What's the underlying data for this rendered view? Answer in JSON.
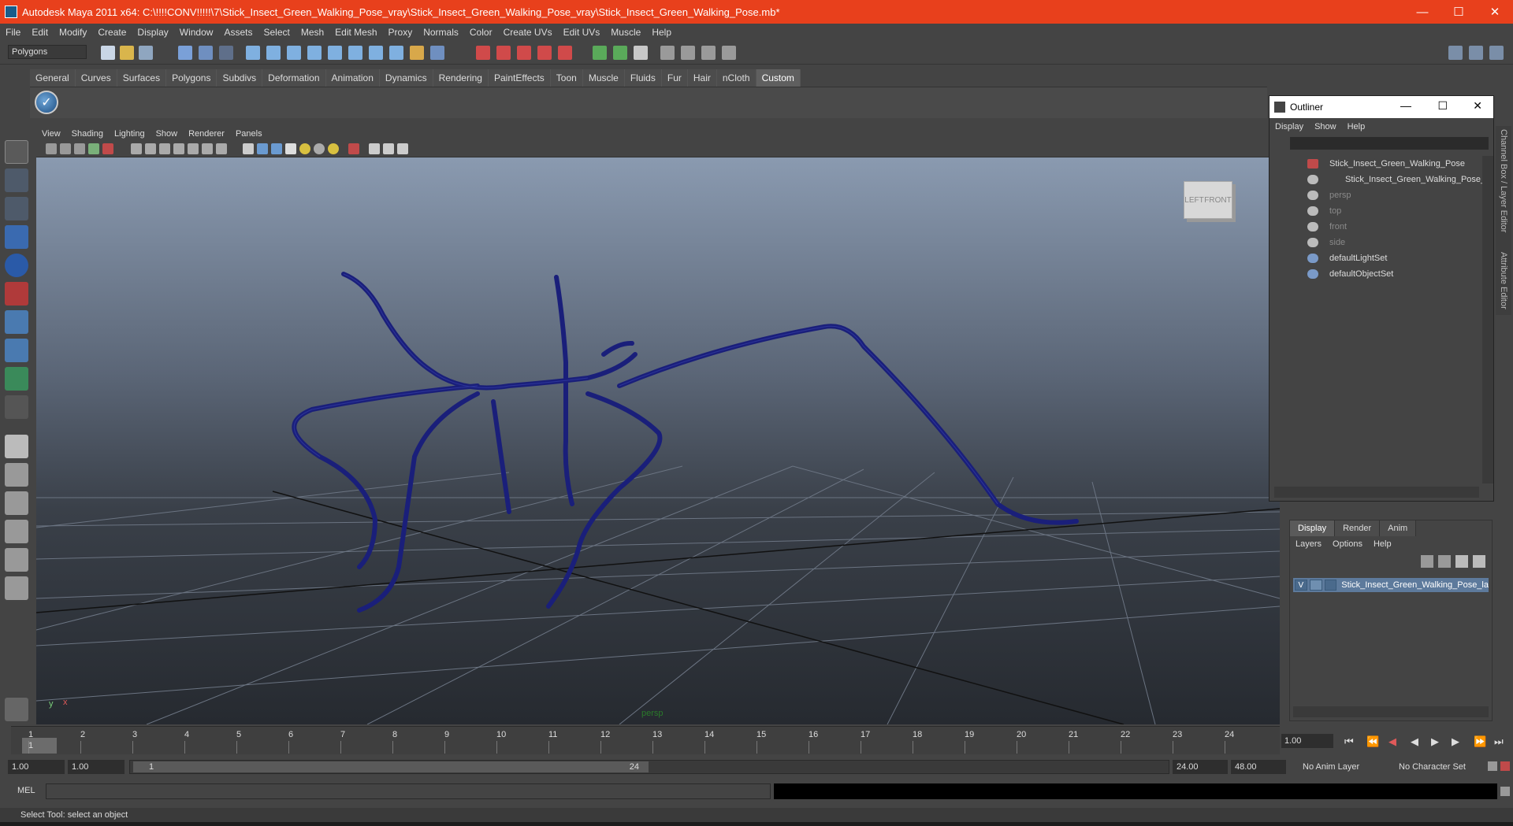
{
  "window": {
    "title": "Autodesk Maya 2011 x64: C:\\!!!!CONV!!!!!\\7\\Stick_Insect_Green_Walking_Pose_vray\\Stick_Insect_Green_Walking_Pose_vray\\Stick_Insect_Green_Walking_Pose.mb*",
    "minimize": "—",
    "maximize": "☐",
    "close": "✕"
  },
  "menubar": [
    "File",
    "Edit",
    "Modify",
    "Create",
    "Display",
    "Window",
    "Assets",
    "Select",
    "Mesh",
    "Edit Mesh",
    "Proxy",
    "Normals",
    "Color",
    "Create UVs",
    "Edit UVs",
    "Muscle",
    "Help"
  ],
  "toolbar": {
    "mode": "Polygons"
  },
  "shelf": {
    "tabs": [
      "General",
      "Curves",
      "Surfaces",
      "Polygons",
      "Subdivs",
      "Deformation",
      "Animation",
      "Dynamics",
      "Rendering",
      "PaintEffects",
      "Toon",
      "Muscle",
      "Fluids",
      "Fur",
      "Hair",
      "nCloth",
      "Custom"
    ],
    "active_tab": "Custom",
    "button_glyph": "✓"
  },
  "viewport": {
    "menus": [
      "View",
      "Shading",
      "Lighting",
      "Show",
      "Renderer",
      "Panels"
    ],
    "camera_label": "persp",
    "viewcube_left": "LEFT",
    "viewcube_front": "FRONT",
    "axis_y": "y",
    "axis_x": "x"
  },
  "outliner": {
    "title": "Outliner",
    "menus": [
      "Display",
      "Show",
      "Help"
    ],
    "items": [
      {
        "label": "Stick_Insect_Green_Walking_Pose",
        "dim": false
      },
      {
        "label": "Stick_Insect_Green_Walking_Pose_",
        "dim": false
      },
      {
        "label": "persp",
        "dim": true
      },
      {
        "label": "top",
        "dim": true
      },
      {
        "label": "front",
        "dim": true
      },
      {
        "label": "side",
        "dim": true
      },
      {
        "label": "defaultLightSet",
        "dim": false
      },
      {
        "label": "defaultObjectSet",
        "dim": false
      }
    ]
  },
  "sidetabs": {
    "channel_box": "Channel Box / Layer Editor",
    "attribute_editor": "Attribute Editor"
  },
  "layers": {
    "tabs": [
      "Display",
      "Render",
      "Anim"
    ],
    "active_tab": "Display",
    "menus": [
      "Layers",
      "Options",
      "Help"
    ],
    "layer_visible": "V",
    "layer_name": "Stick_Insect_Green_Walking_Pose_la"
  },
  "timeline": {
    "ticks": [
      "1",
      "2",
      "3",
      "4",
      "5",
      "6",
      "7",
      "8",
      "9",
      "10",
      "11",
      "12",
      "13",
      "14",
      "15",
      "16",
      "17",
      "18",
      "19",
      "20",
      "21",
      "22",
      "23",
      "24"
    ],
    "current_frame_marker": "1",
    "current_frame": "1.00"
  },
  "range": {
    "start": "1.00",
    "playback_start": "1.00",
    "slider_start": "1",
    "slider_end": "24",
    "playback_end": "24.00",
    "end": "48.00",
    "anim_layer": "No Anim Layer",
    "character_set": "No Character Set"
  },
  "mel": {
    "label": "MEL"
  },
  "status": {
    "text": "Select Tool: select an object"
  },
  "colors": {
    "titlebar": "#e8401c",
    "mesh_wire": "#1a1f7a",
    "selected_layer": "#5d7a9c"
  }
}
